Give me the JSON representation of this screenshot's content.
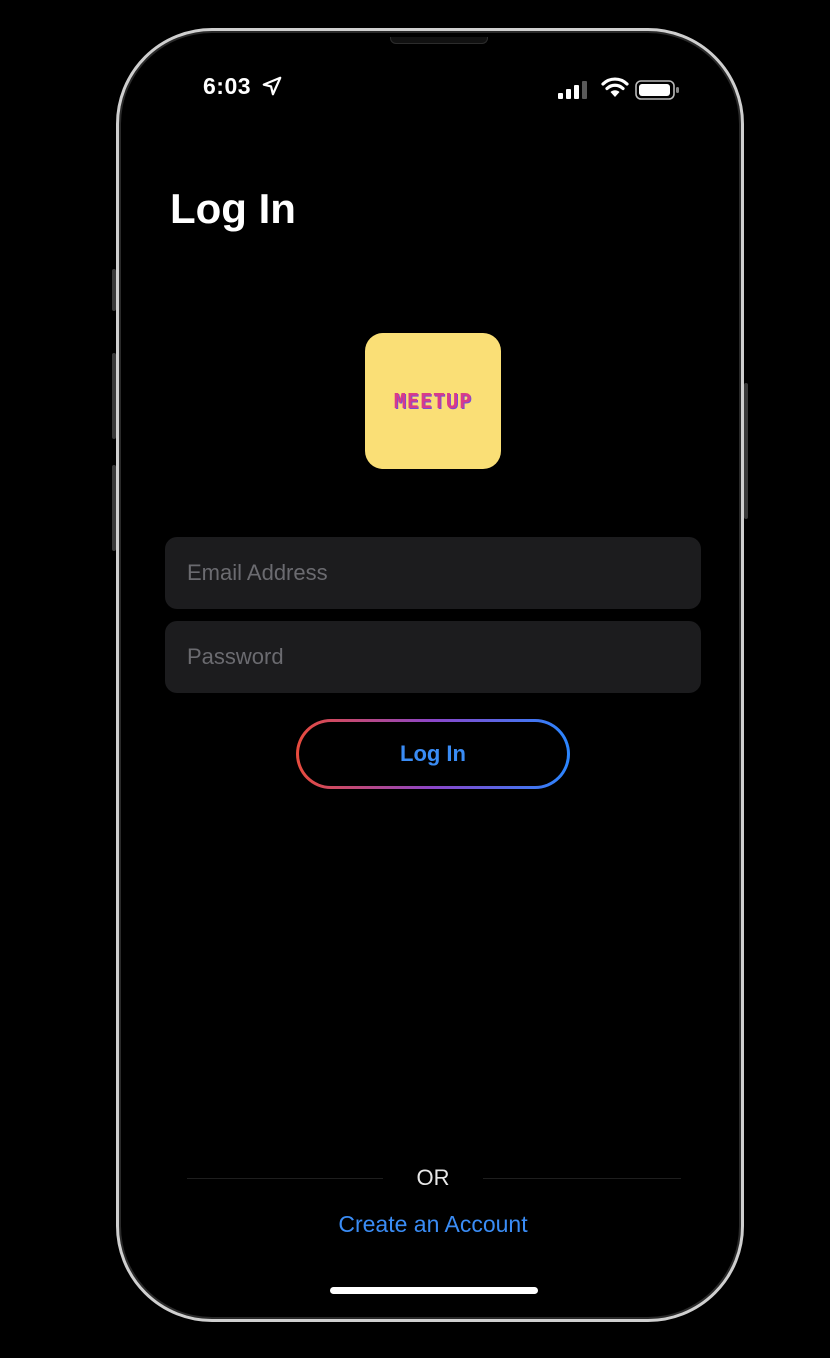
{
  "status_bar": {
    "time": "6:03",
    "location_icon": "location-arrow-icon",
    "signal_icon": "cellular-signal-icon",
    "wifi_icon": "wifi-icon",
    "battery_icon": "battery-icon"
  },
  "page": {
    "title": "Log In"
  },
  "logo": {
    "text": "MEETUP",
    "background_color": "#fadf76",
    "text_color": "#d93a8a"
  },
  "form": {
    "email_placeholder": "Email Address",
    "email_value": "",
    "password_placeholder": "Password",
    "password_value": "",
    "login_label": "Log In"
  },
  "footer": {
    "divider_label": "OR",
    "create_account_label": "Create an Account"
  },
  "colors": {
    "accent": "#3a8cf5",
    "gradient_start": "#e84b3c",
    "gradient_end": "#2a86ff",
    "field_background": "#1c1c1e"
  }
}
